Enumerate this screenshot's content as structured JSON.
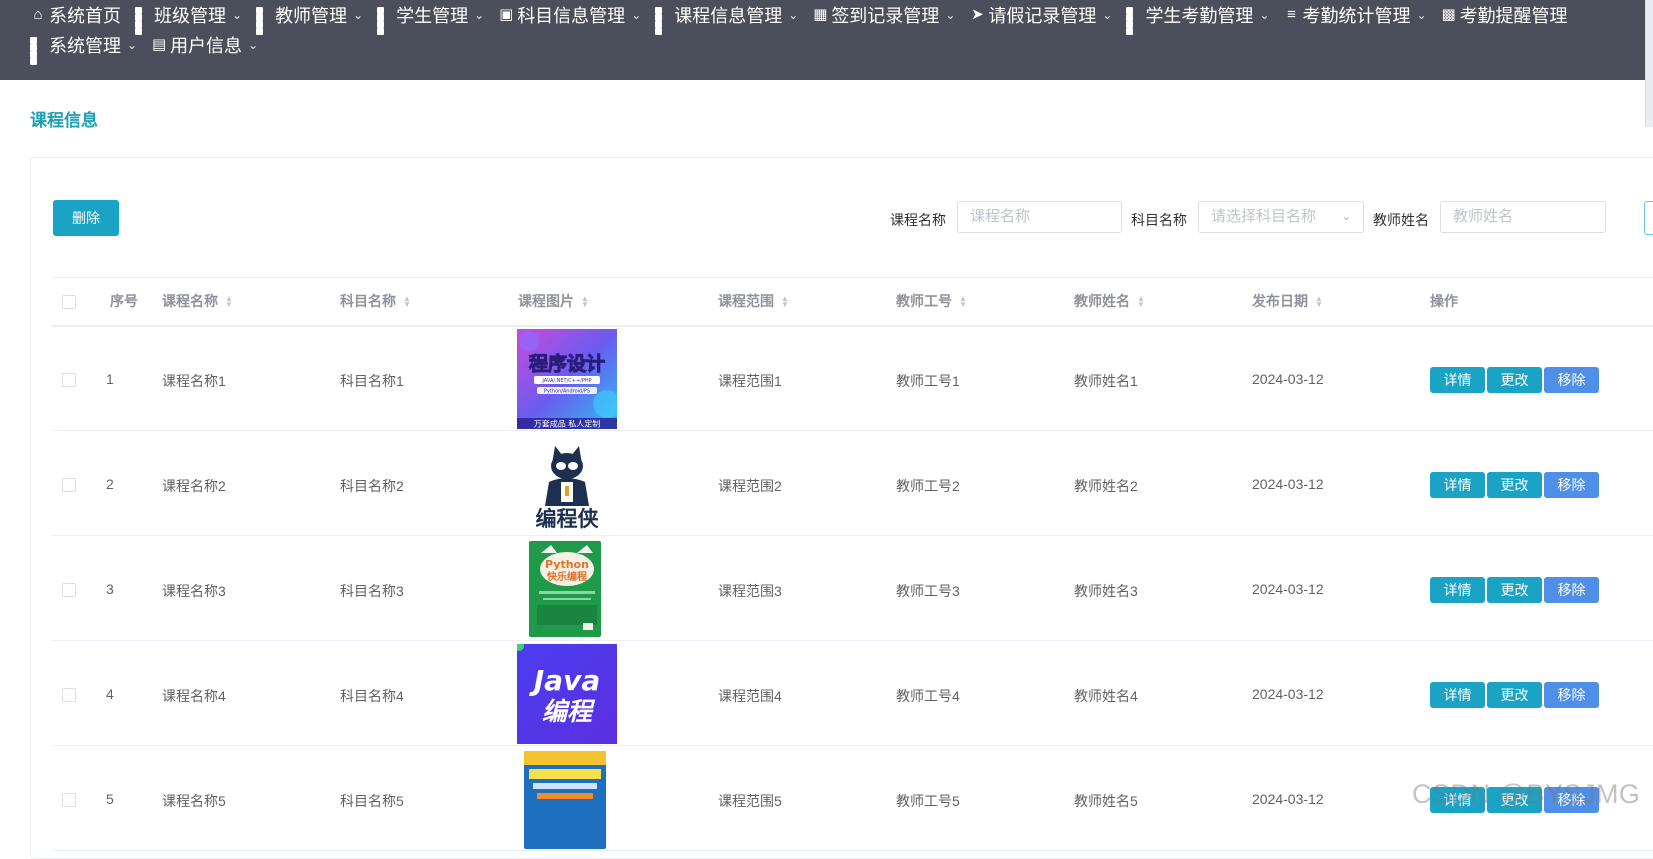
{
  "nav": {
    "row1": [
      {
        "label": "系统首页",
        "icon": "home-icon",
        "caret": false
      },
      {
        "label": "班级管理",
        "icon": "grid-icon",
        "caret": true
      },
      {
        "label": "教师管理",
        "icon": "grid-icon",
        "caret": true
      },
      {
        "label": "学生管理",
        "icon": "grid-icon",
        "caret": true
      },
      {
        "label": "科目信息管理",
        "icon": "briefcase-icon",
        "caret": true
      },
      {
        "label": "课程信息管理",
        "icon": "grid-icon",
        "caret": true
      },
      {
        "label": "签到记录管理",
        "icon": "clipboard-icon",
        "caret": true
      },
      {
        "label": "请假记录管理",
        "icon": "send-icon",
        "caret": true
      },
      {
        "label": "学生考勤管理",
        "icon": "grid-icon",
        "caret": true
      },
      {
        "label": "考勤统计管理",
        "icon": "sliders-icon",
        "caret": true
      },
      {
        "label": "考勤提醒管理",
        "icon": "wallet-icon",
        "caret": false
      }
    ],
    "row2": [
      {
        "label": "系统管理",
        "icon": "grid-icon",
        "caret": true
      },
      {
        "label": "用户信息",
        "icon": "id-card-icon",
        "caret": true
      }
    ]
  },
  "page": {
    "title": "课程信息"
  },
  "toolbar": {
    "delete_label": "删除",
    "course_name_label": "课程名称",
    "course_name_placeholder": "课程名称",
    "subject_label": "科目名称",
    "subject_placeholder": "请选择科目名称",
    "teacher_label": "教师姓名",
    "teacher_placeholder": "教师姓名"
  },
  "table": {
    "headers": {
      "index": "序号",
      "course_name": "课程名称",
      "subject": "科目名称",
      "image": "课程图片",
      "scope": "课程范围",
      "teacher_no": "教师工号",
      "teacher_name": "教师姓名",
      "date": "发布日期",
      "ops": "操作"
    },
    "actions": {
      "detail": "详情",
      "edit": "更改",
      "remove": "移除"
    },
    "rows": [
      {
        "index": "1",
        "course_name": "课程名称1",
        "subject": "科目名称1",
        "image": "programming-design-cover",
        "scope": "课程范围1",
        "teacher_no": "教师工号1",
        "teacher_name": "教师姓名1",
        "date": "2024-03-12"
      },
      {
        "index": "2",
        "course_name": "课程名称2",
        "subject": "科目名称2",
        "image": "coding-cat-logo",
        "scope": "课程范围2",
        "teacher_no": "教师工号2",
        "teacher_name": "教师姓名2",
        "date": "2024-03-12"
      },
      {
        "index": "3",
        "course_name": "课程名称3",
        "subject": "科目名称3",
        "image": "python-book-cover",
        "scope": "课程范围3",
        "teacher_no": "教师工号3",
        "teacher_name": "教师姓名3",
        "date": "2024-03-12"
      },
      {
        "index": "4",
        "course_name": "课程名称4",
        "subject": "科目名称4",
        "image": "java-cover",
        "scope": "课程范围4",
        "teacher_no": "教师工号4",
        "teacher_name": "教师姓名4",
        "date": "2024-03-12"
      },
      {
        "index": "5",
        "course_name": "课程名称5",
        "subject": "科目名称5",
        "image": "kids-coding-book-cover",
        "scope": "课程范围5",
        "teacher_no": "教师工号5",
        "teacher_name": "教师姓名5",
        "date": "2024-03-12"
      }
    ]
  },
  "images": {
    "programming_design": {
      "title": "程序设计",
      "subtitle": "JAVA/.NET/C++/PHP",
      "line2": "Python/Android/PS",
      "bottom": "万套成品  私人定制"
    },
    "coding_cat": {
      "text": "编程侠"
    },
    "python_book": {
      "badge": "Python",
      "title": "快乐编程"
    },
    "java": {
      "line1": "Java",
      "line2": "编程"
    }
  },
  "watermark": "CSDN @BYSJMG",
  "colors": {
    "nav_bg": "#4b4f5c",
    "accent": "#1ba3c6",
    "remove": "#4f8fe8",
    "title": "#1e9fb3"
  }
}
